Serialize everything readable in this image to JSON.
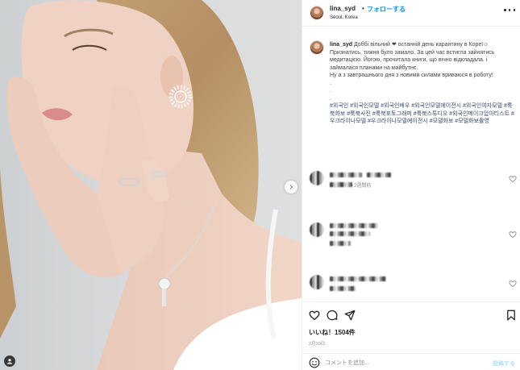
{
  "post": {
    "username": "lina_syd",
    "separator": "•",
    "follow_label": "フォローする",
    "location": "Seoul, Korea",
    "more_icon": "more-horizontal-icon"
  },
  "caption": {
    "username": "lina_syd",
    "body": " Доббі вільний ❤ останній день карантину в Кореї☺\nПризнатись, тижня було замало. За цей час встигла зайнятись медитацією. Йогою, прочитала книги, що вічно відкладала. і займалася планами на майбутнє.\nНу а з завтрашнього дня з новими силами вриваюся в роботу!\n.\n.\n.\n",
    "hashtags": "#외국인 #외국인모델 #외국인배우 #외국인모델에이전시 #외국인여자모델 #룩북화보 #룩북사진 #룩북포토그래퍼 #룩북스튜디오 #외국인메이크업아티스트 #우크라이나모델 #우크라이나모델에이전시 #모델화보 #모델화보촬영",
    "meta": "編集済み・2週間前"
  },
  "actions": {
    "like_icon": "heart-icon",
    "comment_icon": "comment-icon",
    "share_icon": "share-icon",
    "save_icon": "bookmark-icon",
    "likes_label": "いいね！1504件",
    "date": "2月10日"
  },
  "comment_box": {
    "emoji_icon": "emoji-icon",
    "placeholder": "コメントを追加...",
    "post_label": "投稿する"
  },
  "colors": {
    "accent": "#0095f6",
    "text": "#262626",
    "muted": "#8e8e8e",
    "post_disabled": "#b2dffc"
  }
}
